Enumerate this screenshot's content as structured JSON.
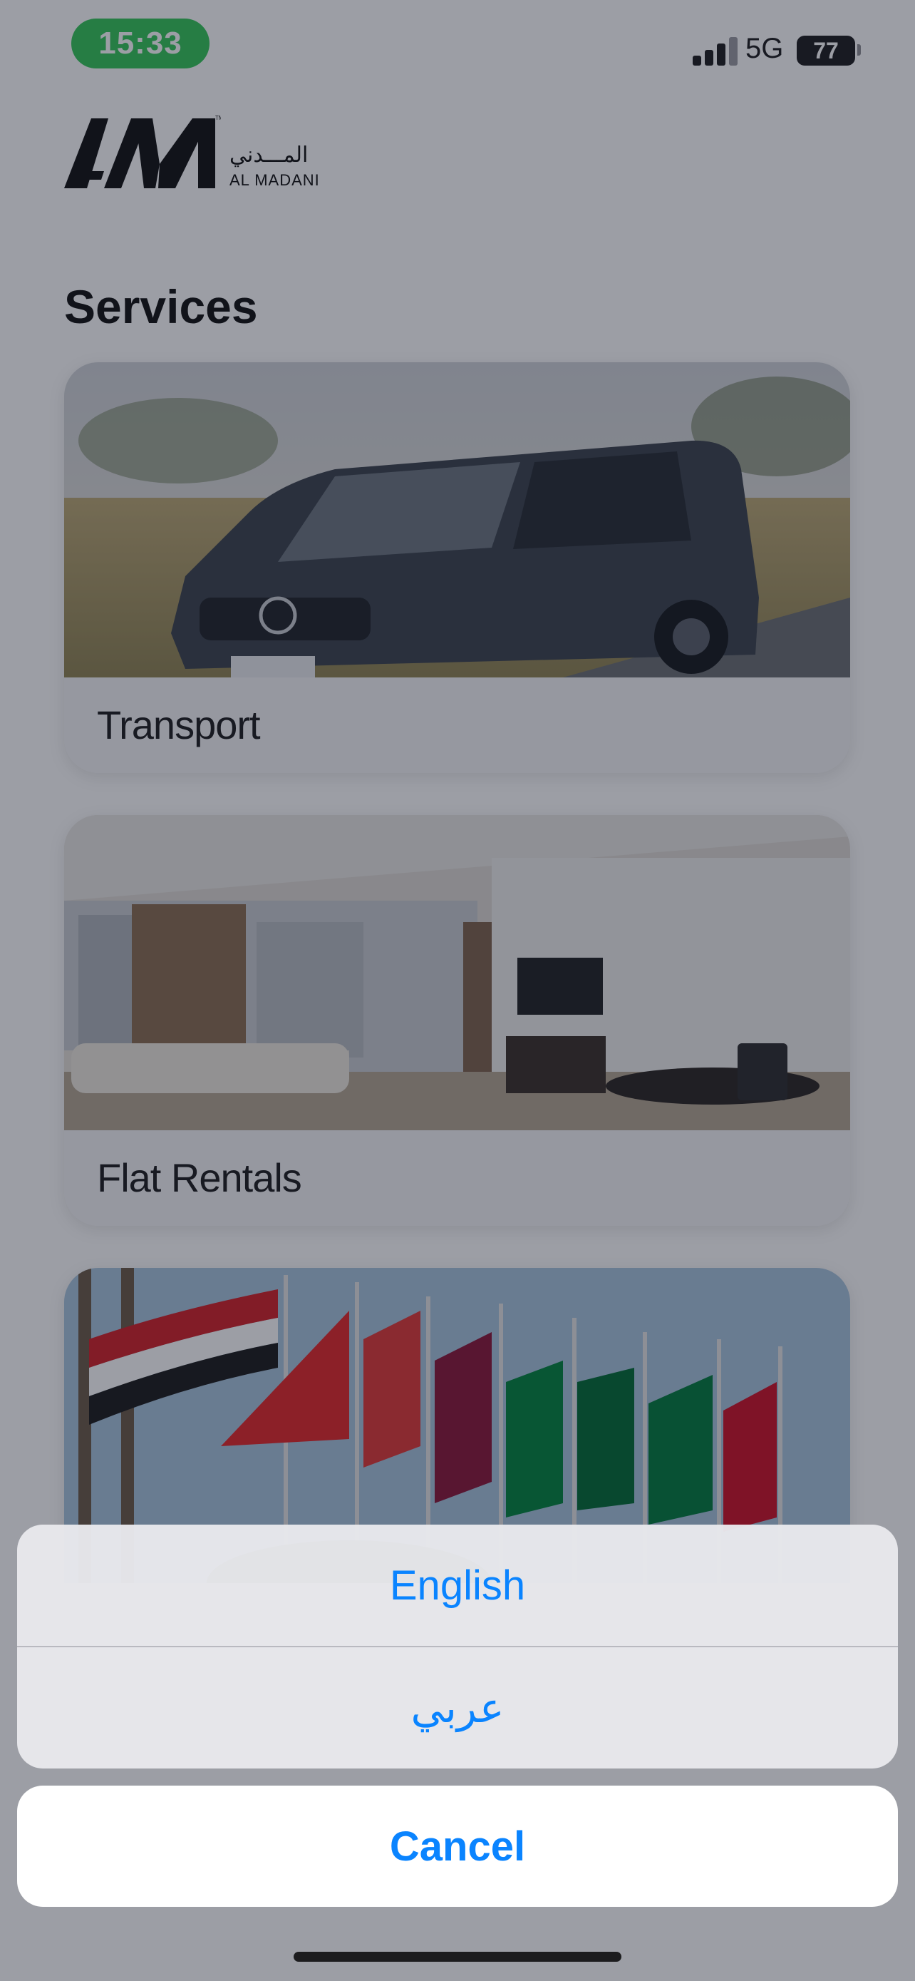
{
  "status_bar": {
    "time": "15:33",
    "network": "5G",
    "battery": "77",
    "time_pill_color": "#34c759"
  },
  "logo": {
    "arabic_text": "المـــدني",
    "english_text": "AL MADANI"
  },
  "page": {
    "title": "Services"
  },
  "services": [
    {
      "label": "Transport",
      "icon": "van-photo"
    },
    {
      "label": "Flat Rentals",
      "icon": "living-room-photo"
    },
    {
      "label": "",
      "icon": "flags-photo"
    }
  ],
  "action_sheet": {
    "options": [
      "English",
      "عربي"
    ],
    "cancel_label": "Cancel",
    "accent_color": "#0a84ff"
  }
}
